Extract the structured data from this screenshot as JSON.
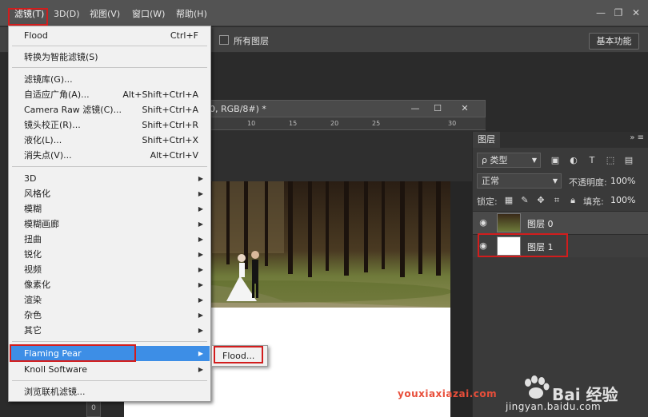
{
  "menubar": {
    "items": [
      {
        "label": "滤镜(T)"
      },
      {
        "label": "3D(D)"
      },
      {
        "label": "视图(V)"
      },
      {
        "label": "窗口(W)"
      },
      {
        "label": "帮助(H)"
      }
    ],
    "window_controls": [
      "—",
      "❐",
      "✕"
    ]
  },
  "options_bar": {
    "all_layers_label": "所有图层",
    "workspace_button": "基本功能"
  },
  "document": {
    "title_fragment": "0, RGB/8#) *",
    "ruler_ticks": [
      "10",
      "15",
      "20",
      "25",
      "30"
    ],
    "controls": [
      "—",
      "☐",
      "✕"
    ],
    "sidebar_value": "0"
  },
  "filter_menu": {
    "items": [
      {
        "label": "Flood",
        "shortcut": "Ctrl+F"
      },
      {
        "label": "转换为智能滤镜(S)",
        "shortcut": ""
      },
      {
        "label": "滤镜库(G)...",
        "shortcut": ""
      },
      {
        "label": "自适应广角(A)...",
        "shortcut": "Alt+Shift+Ctrl+A"
      },
      {
        "label": "Camera Raw 滤镜(C)...",
        "shortcut": "Shift+Ctrl+A"
      },
      {
        "label": "镜头校正(R)...",
        "shortcut": "Shift+Ctrl+R"
      },
      {
        "label": "液化(L)...",
        "shortcut": "Shift+Ctrl+X"
      },
      {
        "label": "消失点(V)...",
        "shortcut": "Alt+Ctrl+V"
      },
      {
        "label": "3D",
        "shortcut": ""
      },
      {
        "label": "风格化",
        "shortcut": ""
      },
      {
        "label": "模糊",
        "shortcut": ""
      },
      {
        "label": "模糊画廊",
        "shortcut": ""
      },
      {
        "label": "扭曲",
        "shortcut": ""
      },
      {
        "label": "锐化",
        "shortcut": ""
      },
      {
        "label": "视频",
        "shortcut": ""
      },
      {
        "label": "像素化",
        "shortcut": ""
      },
      {
        "label": "渲染",
        "shortcut": ""
      },
      {
        "label": "杂色",
        "shortcut": ""
      },
      {
        "label": "其它",
        "shortcut": ""
      },
      {
        "label": "Flaming Pear",
        "shortcut": ""
      },
      {
        "label": "Knoll Software",
        "shortcut": ""
      },
      {
        "label": "浏览联机滤镜...",
        "shortcut": ""
      }
    ]
  },
  "submenu": {
    "items": [
      {
        "label": "Flood..."
      }
    ]
  },
  "layers_panel": {
    "tab": "图层",
    "menu_glyph": "»  ≡",
    "kind_label": "ρ 类型",
    "blend_mode": "正常",
    "opacity_label": "不透明度:",
    "opacity_value": "100%",
    "lock_label": "锁定:",
    "fill_label": "填充:",
    "fill_value": "100%",
    "layers": [
      {
        "name": "图层 0"
      },
      {
        "name": "图层 1"
      }
    ]
  },
  "watermarks": {
    "site": "youxiaxiazai.com",
    "brand": "Bai 经验",
    "url": "jingyan.baidu.com"
  },
  "colors": {
    "highlight": "#3d8ee6",
    "annotation_red": "#d21d1d"
  }
}
